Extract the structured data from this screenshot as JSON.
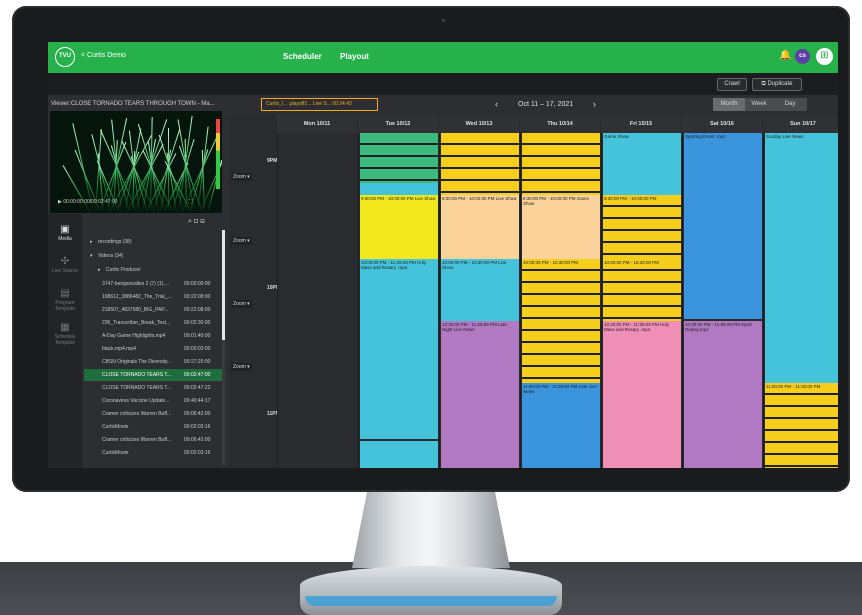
{
  "app": {
    "logo_text": "TVU",
    "back_label": "< Curtis Demo",
    "tabs": [
      "Scheduler",
      "Playout"
    ],
    "avatar_initials": "cs",
    "colors": {
      "brand": "#27b14a",
      "selection": "#1f6e3e",
      "clip_accent": "#f5a623"
    }
  },
  "toolbar": {
    "crawl_label": "Crawl",
    "duplicate_label": "Duplicate"
  },
  "viewer": {
    "title": "Viewer:CLOSE TORNADO TEARS THROUGH TOWN - Ma...",
    "timecode": "00:00:00:00/00:02:47:00"
  },
  "sidebar": {
    "items": [
      {
        "label": "Media",
        "icon": "media-icon"
      },
      {
        "label": "Live Source",
        "icon": "live-source-icon"
      },
      {
        "label": "Program Template",
        "icon": "program-template-icon"
      },
      {
        "label": "Schedule Template",
        "icon": "schedule-template-icon"
      }
    ]
  },
  "media": {
    "folders": [
      {
        "name": "recordings (38)"
      },
      {
        "name": "Videos (34)"
      },
      {
        "name": "Curtis Producer"
      }
    ],
    "files": [
      {
        "name": "3747-bengancalles 2 (7) (1)....",
        "duration": "00:00:00:00"
      },
      {
        "name": "198612_3886482_The_Trial_...",
        "duration": "00:22:08:00"
      },
      {
        "name": "218507_4837580_BIG_PAP...",
        "duration": "00:22:08:00"
      },
      {
        "name": "236_Transcriber_Break_Test...",
        "duration": "00:02:30:00"
      },
      {
        "name": "A-Day Game Highlights.mp4",
        "duration": "00:01:40:00"
      },
      {
        "name": "black.mp4.mp4",
        "duration": "00:00:03:00"
      },
      {
        "name": "CBSN Originals The Diversity...",
        "duration": "00:27:25:00"
      },
      {
        "name": "CLOSE TORNADO TEARS T...",
        "duration": "00:02:47:00"
      },
      {
        "name": "CLOSE TORNADO TEARS T...",
        "duration": "00:02:47:22"
      },
      {
        "name": "Coronavirus Vaccine Update...",
        "duration": "00:40:44:17"
      },
      {
        "name": "Cramer criticizes Warren Buff...",
        "duration": "00:06:42:00"
      },
      {
        "name": "CurtisMovie",
        "duration": "00:02:03:16"
      },
      {
        "name": "Cramer criticizes Warren Buff...",
        "duration": "00:06:42:00"
      },
      {
        "name": "CurtisMovie",
        "duration": "00:02:03:16"
      }
    ],
    "selected_index": 7
  },
  "scheduler": {
    "clip_label": "Curtis_l... .playoff1... Live S... 00:24:43",
    "date_range": "Oct 11 – 17, 2021",
    "views": [
      "Month",
      "Week",
      "Day"
    ],
    "active_view": "Week",
    "zoom_label": "Zoom ▾",
    "hours": [
      "9PM",
      "10PM",
      "11PM"
    ],
    "days": [
      "Mon 10/11",
      "Tue 10/12",
      "Wed 10/13",
      "Thu 10/14",
      "Fri 10/15",
      "Sat 10/16",
      "Sun 10/17"
    ],
    "events": {
      "tue_show": "9:30:00 PM - 10:00:00 PM Live Show",
      "tue_late": "10:00:00 PM - 11:29:29 PM Holy Mass and Rosary .mp4",
      "wed_show": "9:30:00 PM - 10:00:00 PM Live Show",
      "wed_live": "10:00:00 PM - 10:30:00 PM Live Show",
      "wed_news": "10:30:00 PM - 11:59:59 PM Late Night Live News",
      "thu_game": "9:30:00 PM - 10:00:00 PM Game Show",
      "thu_late": "10:00:00 PM - 10:30:00 PM",
      "thu_news": "11:00:00 PM - 11:59:59 PM Late Live News",
      "fri_top": "Game Show",
      "fri_mid": "9:30:00 PM - 10:00:00 PM",
      "fri_late": "10:00:00 PM - 10:30:00 PM",
      "fri_mass": "10:30:00 PM - 11:59:29 PM Holy Mass and Rosary .mp4",
      "sat_top": "Sporting Event .mp4",
      "sat_replay": "10:30:00 PM - 11:59:29 PM Sport Replay.mp4",
      "sun_top": "Sunday Live News",
      "sun_late": "11:00:00 PM - 11:30:00 PM"
    }
  }
}
